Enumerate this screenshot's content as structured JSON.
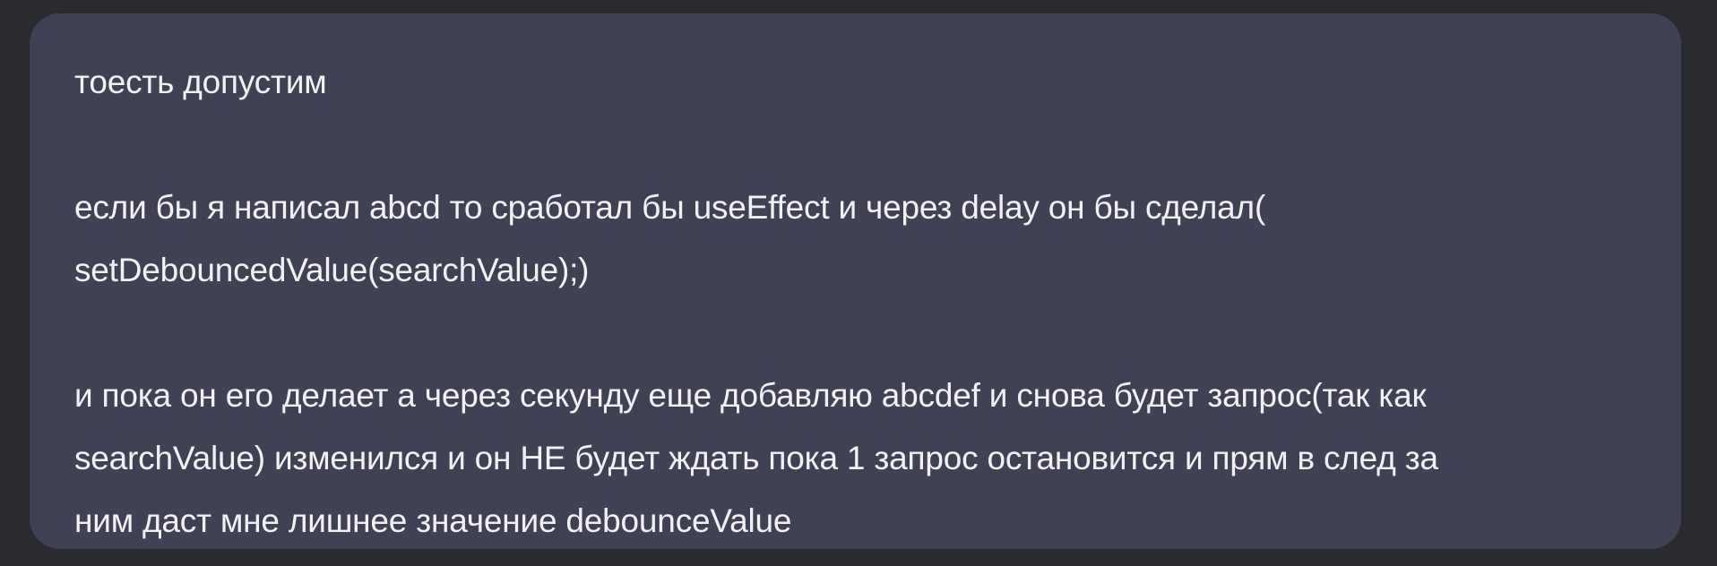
{
  "message": {
    "lines": [
      "тоесть допустим",
      "",
      "если бы я написал abcd то сработал бы useEffect и через delay он бы сделал(",
      "setDebouncedValue(searchValue);)",
      "",
      "и пока он его делает а через секунду еще добавляю abcdef и снова будет запрос(так как",
      "searchValue) изменился и он НЕ будет ждать пока 1 запрос остановится и прям в след за",
      "ним даст мне лишнее значение debounceValue"
    ]
  }
}
